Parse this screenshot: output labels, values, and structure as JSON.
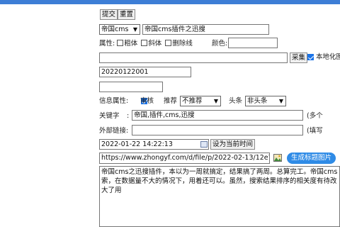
{
  "toolbar": {
    "submit_label": "提交",
    "reset_label": "重置"
  },
  "title_row": {
    "category_value": "帝国cms",
    "title_value": "帝国cms插件之迅搜"
  },
  "attributes": {
    "label": "属性:",
    "bold_label": "粗体",
    "italic_label": "斜体",
    "strike_label": "删除线",
    "color_label": "颜色:"
  },
  "image_row": {
    "collect_label": "采集",
    "localize_label": "本地化图"
  },
  "number_field": {
    "value": "20220122001"
  },
  "info_row": {
    "info_label": "信息属性:",
    "review_label": "审核",
    "recommend_label": "推荐",
    "recommend_value": "不推荐",
    "headline_label": "头条",
    "headline_value": "非头条"
  },
  "keywords": {
    "label": "关键字",
    "colon": ":",
    "value": "帝国,插件,cms,迅搜",
    "hint": "(多个"
  },
  "external_link": {
    "label": "外部链接:",
    "hint": "(填写"
  },
  "datetime": {
    "value": "2022-01-22 14:22:13",
    "set_now_label": "设为当前时间"
  },
  "title_image": {
    "url_value": "https://www.zhongyf.com/d/file/p/2022-02-13/12e70be",
    "generate_label": "生成标题图片"
  },
  "summary": {
    "text": "帝国cms之迅搜插件，本以为一周就搞定，结果搞了两周。总算完工。帝国cms 索，在数据量不大的情况下，用着还可以。虽然，搜索结果排序的相关度有待改 大了用"
  }
}
